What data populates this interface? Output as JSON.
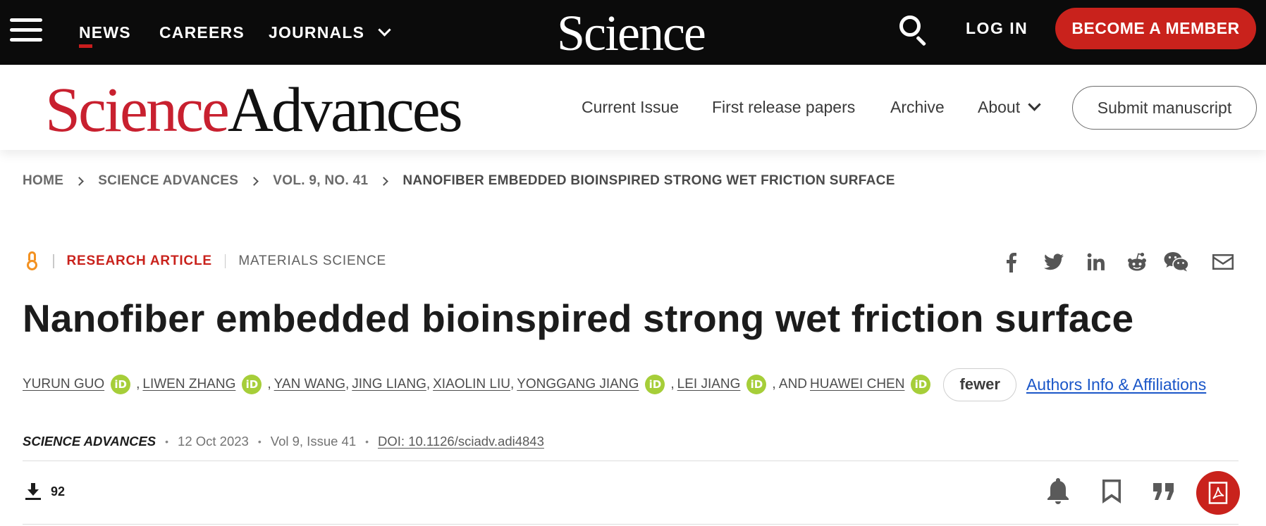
{
  "topbar": {
    "nav": [
      "NEWS",
      "CAREERS",
      "JOURNALS"
    ],
    "logo": "Science",
    "login": "LOG IN",
    "member_button": "BECOME A MEMBER"
  },
  "journal": {
    "logo_part1": "Science",
    "logo_part2": "Advances",
    "nav": [
      "Current Issue",
      "First release papers",
      "Archive",
      "About"
    ],
    "submit_button": "Submit manuscript"
  },
  "breadcrumb": [
    "HOME",
    "SCIENCE ADVANCES",
    "VOL. 9, NO. 41",
    "NANOFIBER EMBEDDED BIOINSPIRED STRONG WET FRICTION SURFACE"
  ],
  "article": {
    "type": "RESEARCH ARTICLE",
    "subject": "MATERIALS SCIENCE",
    "title": "Nanofiber embedded bioinspired strong wet friction surface",
    "authors": [
      {
        "name": "YURUN GUO",
        "orcid": true
      },
      {
        "name": "LIWEN ZHANG",
        "orcid": true
      },
      {
        "name": "YAN WANG",
        "orcid": false
      },
      {
        "name": "JING LIANG",
        "orcid": false
      },
      {
        "name": "XIAOLIN LIU",
        "orcid": false
      },
      {
        "name": "YONGGANG JIANG",
        "orcid": true
      },
      {
        "name": "LEI JIANG",
        "orcid": true
      },
      {
        "name": "HUAWEI CHEN",
        "orcid": true
      }
    ],
    "separators": [
      ",",
      ",",
      ",",
      ",",
      ",",
      ",",
      ", AND"
    ],
    "orcid_label": "iD",
    "fewer_button": "fewer",
    "affiliations_link": "Authors Info & Affiliations",
    "journal_name": "SCIENCE ADVANCES",
    "date": "12 Oct 2023",
    "volume": "Vol 9, Issue 41",
    "doi": "DOI: 10.1126/sciadv.adi4843",
    "downloads": "92"
  },
  "share_icons": [
    "facebook-icon",
    "twitter-icon",
    "linkedin-icon",
    "reddit-icon",
    "wechat-icon",
    "email-icon"
  ],
  "toolbar_icons": [
    "bell-icon",
    "bookmark-icon",
    "quote-icon",
    "pdf-icon"
  ],
  "colors": {
    "brand_red": "#c9221c",
    "orcid_green": "#a6ce39",
    "open_access_orange": "#f39121",
    "link_blue": "#1a56c8"
  }
}
